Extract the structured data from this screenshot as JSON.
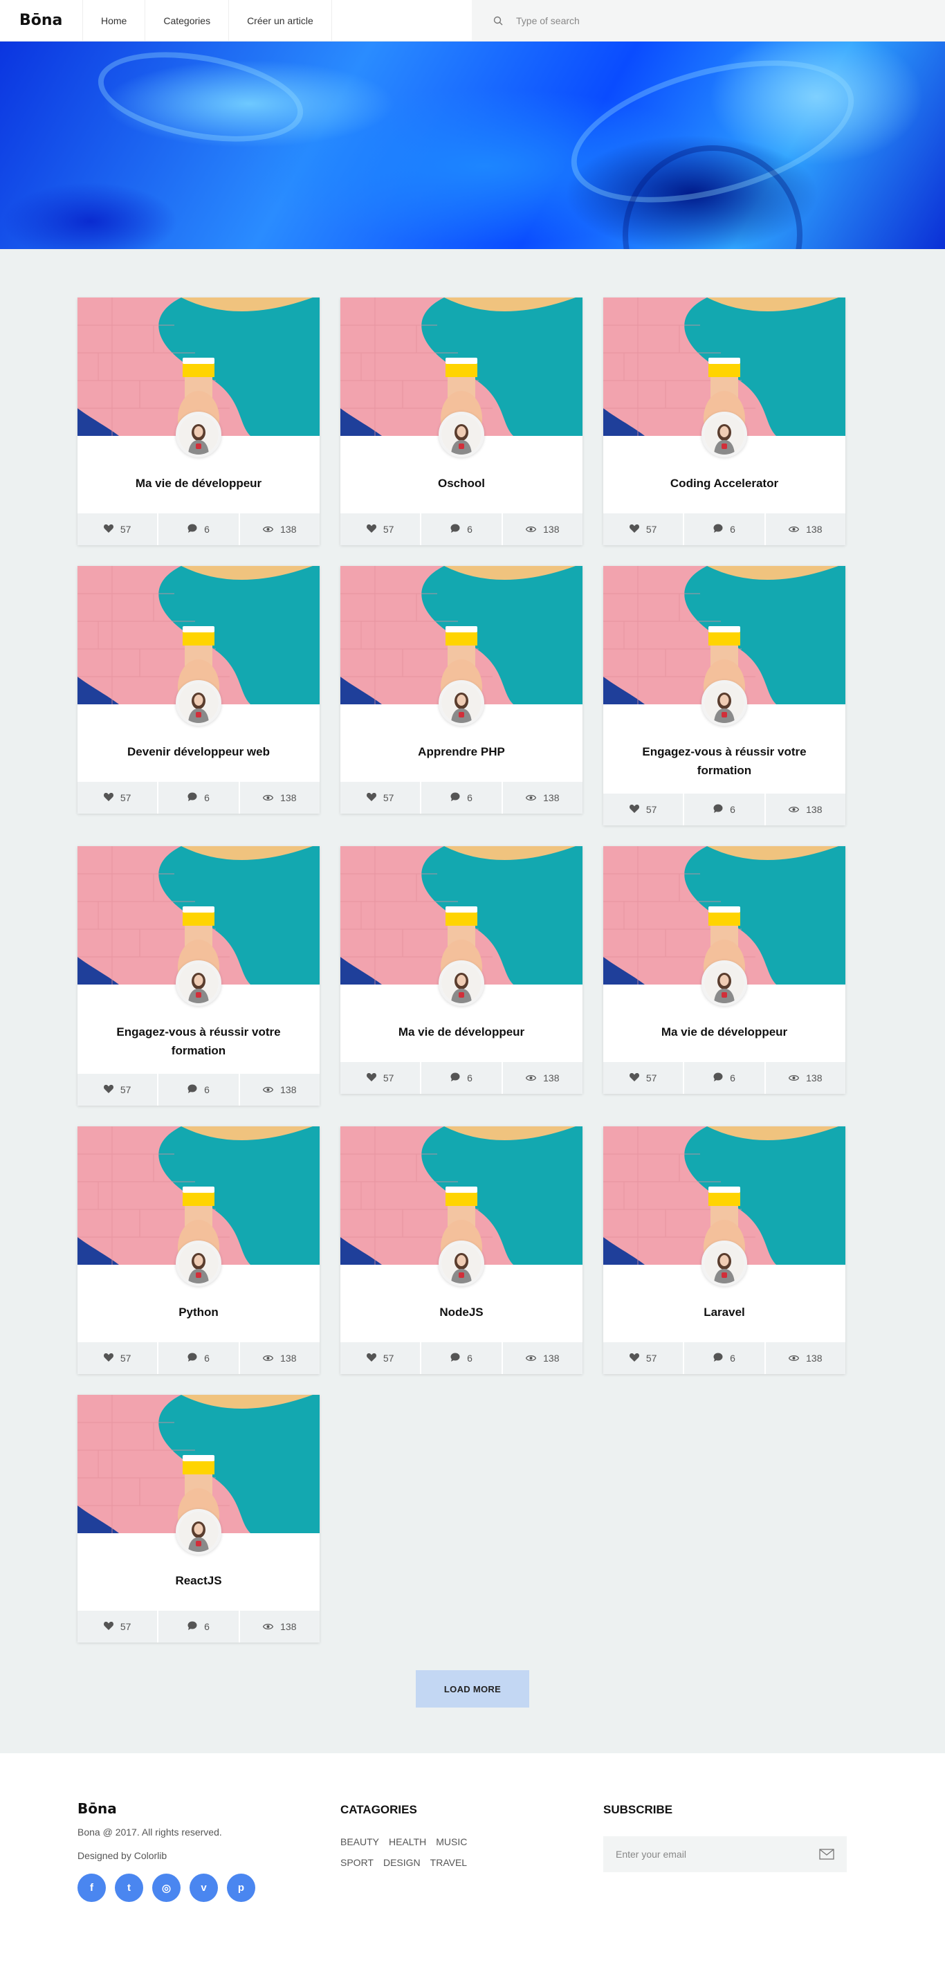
{
  "header": {
    "logo": "Bōna",
    "nav": [
      "Home",
      "Categories",
      "Créer un article"
    ],
    "search_placeholder": "Type of search"
  },
  "posts": [
    {
      "title": "Ma vie de développeur",
      "likes": "57",
      "comments": "6",
      "views": "138"
    },
    {
      "title": "Oschool",
      "likes": "57",
      "comments": "6",
      "views": "138"
    },
    {
      "title": "Coding Accelerator",
      "likes": "57",
      "comments": "6",
      "views": "138"
    },
    {
      "title": "Devenir développeur web",
      "likes": "57",
      "comments": "6",
      "views": "138"
    },
    {
      "title": "Apprendre PHP",
      "likes": "57",
      "comments": "6",
      "views": "138"
    },
    {
      "title": "Engagez-vous à réussir votre formation",
      "likes": "57",
      "comments": "6",
      "views": "138"
    },
    {
      "title": "Engagez-vous à réussir votre formation",
      "likes": "57",
      "comments": "6",
      "views": "138"
    },
    {
      "title": "Ma vie de développeur",
      "likes": "57",
      "comments": "6",
      "views": "138"
    },
    {
      "title": "Ma vie de développeur",
      "likes": "57",
      "comments": "6",
      "views": "138"
    },
    {
      "title": "Python",
      "likes": "57",
      "comments": "6",
      "views": "138"
    },
    {
      "title": "NodeJS",
      "likes": "57",
      "comments": "6",
      "views": "138"
    },
    {
      "title": "Laravel",
      "likes": "57",
      "comments": "6",
      "views": "138"
    },
    {
      "title": "ReactJS",
      "likes": "57",
      "comments": "6",
      "views": "138"
    }
  ],
  "load_more": "LOAD MORE",
  "footer": {
    "logo": "Bōna",
    "copyright": "Bona @ 2017. All rights reserved.",
    "designed_by": "Designed by Colorlib",
    "socials": [
      {
        "icon": "facebook-icon",
        "glyph": "f"
      },
      {
        "icon": "twitter-icon",
        "glyph": "t"
      },
      {
        "icon": "instagram-icon",
        "glyph": "◎"
      },
      {
        "icon": "vimeo-icon",
        "glyph": "v"
      },
      {
        "icon": "pinterest-icon",
        "glyph": "p"
      }
    ],
    "categories_heading": "CATAGORIES",
    "categories": [
      "BEAUTY",
      "HEALTH",
      "MUSIC",
      "SPORT",
      "DESIGN",
      "TRAVEL"
    ],
    "subscribe_heading": "SUBSCRIBE",
    "email_placeholder": "Enter your email"
  },
  "colors": {
    "accent": "#4a86f0",
    "load_more_bg": "#c3d7f3",
    "page_bg": "#edf1f1"
  }
}
